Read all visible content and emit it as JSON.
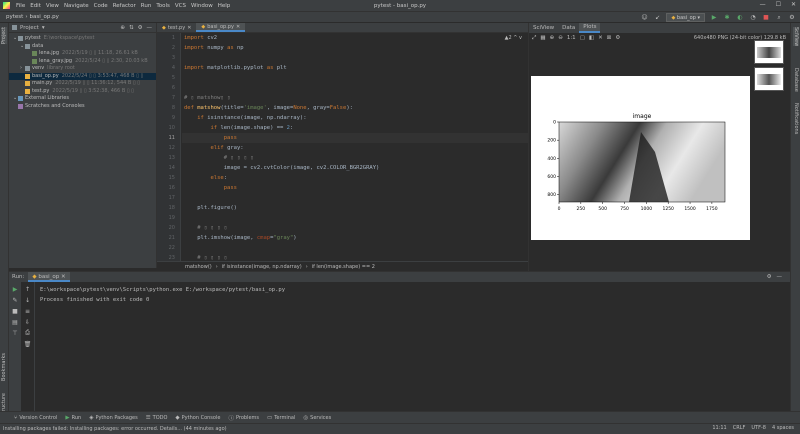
{
  "app": {
    "window_title": "pytest - basi_op.py",
    "menu": [
      "File",
      "Edit",
      "View",
      "Navigate",
      "Code",
      "Refactor",
      "Run",
      "Tools",
      "VCS",
      "Window",
      "Help"
    ],
    "breadcrumb": [
      "pytest",
      "basi_op.py"
    ],
    "run_config": "basi_op"
  },
  "project": {
    "header": "Project",
    "tree": [
      {
        "label": "pytest",
        "meta": "E:\\workspace\\pytest",
        "indent": 0,
        "type": "folder"
      },
      {
        "label": "data",
        "meta": "",
        "indent": 1,
        "type": "folder"
      },
      {
        "label": "lena.jpg",
        "meta": "2022/5/19 ▯ ▯ 11:18, 26.61 kB",
        "indent": 2,
        "type": "file"
      },
      {
        "label": "lena_gray.jpg",
        "meta": "2022/5/24 ▯ ▯ 2:30, 20.03 kB",
        "indent": 2,
        "type": "file"
      },
      {
        "label": "venv",
        "meta": "library root",
        "indent": 1,
        "type": "folder"
      },
      {
        "label": "basi_op.py",
        "meta": "2022/5/24 ▯ ▯ 3:53:47, 468 B ▯ ▯",
        "indent": 1,
        "type": "py",
        "selected": true
      },
      {
        "label": "main.py",
        "meta": "2022/5/19 ▯ ▯ 11:36:12, 544 B ▯ ▯",
        "indent": 1,
        "type": "py"
      },
      {
        "label": "test.py",
        "meta": "2022/5/19 ▯ ▯ 3:52:38, 466 B ▯ ▯",
        "indent": 1,
        "type": "py"
      },
      {
        "label": "External Libraries",
        "meta": "",
        "indent": 0,
        "type": "lib"
      },
      {
        "label": "Scratches and Consoles",
        "meta": "",
        "indent": 0,
        "type": "scratch"
      }
    ]
  },
  "editor": {
    "tabs": [
      {
        "label": "test.py",
        "active": false
      },
      {
        "label": "basi_op.py",
        "active": true
      }
    ],
    "warning": "▲2 ^ v",
    "lines": [
      [
        [
          "kw",
          "import "
        ],
        [
          "",
          "cv2"
        ]
      ],
      [
        [
          "kw",
          "import "
        ],
        [
          "",
          "numpy "
        ],
        [
          "kw",
          "as "
        ],
        [
          "",
          "np"
        ]
      ],
      [],
      [
        [
          "kw",
          "import "
        ],
        [
          "",
          "matplotlib.pyplot "
        ],
        [
          "kw",
          "as "
        ],
        [
          "",
          "plt"
        ]
      ],
      [],
      [],
      [
        [
          "cm",
          "# ▯ matshow▯ ▯"
        ]
      ],
      [
        [
          "kw",
          "def "
        ],
        [
          "fn",
          "matshow"
        ],
        [
          "",
          "(title="
        ],
        [
          "st",
          "'image'"
        ],
        [
          "",
          ", image="
        ],
        [
          "kw",
          "None"
        ],
        [
          "",
          ", gray="
        ],
        [
          "kw",
          "False"
        ],
        [
          "",
          "):"
        ]
      ],
      [
        [
          "",
          "    "
        ],
        [
          "kw",
          "if "
        ],
        [
          "",
          "isinstance(image, np.ndarray):"
        ]
      ],
      [
        [
          "",
          "        "
        ],
        [
          "kw",
          "if "
        ],
        [
          "",
          "len(image.shape) == "
        ],
        [
          "num",
          "2"
        ],
        [
          "",
          ":"
        ]
      ],
      [
        [
          "",
          "            "
        ],
        [
          "kw",
          "pass"
        ]
      ],
      [
        [
          "",
          "        "
        ],
        [
          "kw",
          "elif "
        ],
        [
          "",
          "gray:"
        ]
      ],
      [
        [
          "",
          "            "
        ],
        [
          "cm",
          "# ▯ ▯ ▯ ▯"
        ]
      ],
      [
        [
          "",
          "            image = cv2.cvtColor(image, cv2.COLOR_BGR2GRAY)"
        ]
      ],
      [
        [
          "",
          "        "
        ],
        [
          "kw",
          "else"
        ],
        [
          "",
          ":"
        ]
      ],
      [
        [
          "",
          "            "
        ],
        [
          "kw",
          "pass"
        ]
      ],
      [],
      [
        [
          "",
          "    plt.figure()"
        ]
      ],
      [],
      [
        [
          "",
          "    "
        ],
        [
          "cm",
          "# ▯ ▯ ▯ ▯"
        ]
      ],
      [
        [
          "",
          "    plt.imshow(image, "
        ],
        [
          "pm",
          "cmap"
        ],
        [
          "",
          "="
        ],
        [
          "st",
          "\"gray\""
        ],
        [
          "",
          ")"
        ]
      ],
      [],
      [
        [
          "",
          "    "
        ],
        [
          "cm",
          "# ▯ ▯ ▯ ▯"
        ]
      ],
      [
        [
          "",
          "    plt.title(title)"
        ]
      ]
    ],
    "line_numbers": [
      "1",
      "2",
      "3",
      "4",
      "5",
      "6",
      "7",
      "8",
      "9",
      "10",
      "11",
      "12",
      "13",
      "14",
      "15",
      "16",
      "17",
      "18",
      "19",
      "20",
      "21",
      "22",
      "23"
    ],
    "current_line": 11,
    "breadcrumb": [
      "matshow()",
      "if isinstance(image, np.ndarray)",
      "if len(image.shape) == 2"
    ]
  },
  "sciview": {
    "tabs": [
      {
        "label": "SciView",
        "active": false
      },
      {
        "label": "Data",
        "active": false
      },
      {
        "label": "Plots",
        "active": true
      }
    ],
    "plot_info": "640x480 PNG (24-bit color) 129.8 kB"
  },
  "chart_data": {
    "type": "image",
    "title": "image",
    "x_ticks": [
      "0",
      "250",
      "500",
      "750",
      "1000",
      "1250",
      "1500",
      "1750"
    ],
    "y_ticks": [
      "0",
      "200",
      "400",
      "600",
      "800"
    ],
    "xlim": [
      0,
      1900
    ],
    "ylim": [
      880,
      0
    ]
  },
  "run": {
    "label": "Run:",
    "tab": "basi_op",
    "console_lines": [
      "E:\\workspace\\pytest\\venv\\Scripts\\python.exe E:/workspace/pytest/basi_op.py",
      "",
      "Process finished with exit code 0"
    ]
  },
  "bottom_tools": [
    {
      "label": "Version Control",
      "icon": "branch-icon"
    },
    {
      "label": "Run",
      "icon": "play-icon"
    },
    {
      "label": "Python Packages",
      "icon": "package-icon"
    },
    {
      "label": "TODO",
      "icon": "list-icon"
    },
    {
      "label": "Python Console",
      "icon": "console-icon"
    },
    {
      "label": "Problems",
      "icon": "problems-icon"
    },
    {
      "label": "Terminal",
      "icon": "terminal-icon"
    },
    {
      "label": "Services",
      "icon": "services-icon"
    }
  ],
  "status": {
    "message": "Installing packages failed: Installing packages: error occurred. Details... (44 minutes ago)",
    "position": "11:11",
    "line_sep": "CRLF",
    "encoding": "UTF-8",
    "indent": "4 spaces"
  },
  "stripes": {
    "left": [
      "Project",
      "Bookmarks",
      "Structure"
    ],
    "right": [
      "SciView",
      "Database",
      "Notifications"
    ]
  },
  "colors": {
    "accent": "#4a88c7",
    "run_green": "#59a869",
    "stop_red": "#e05555"
  }
}
